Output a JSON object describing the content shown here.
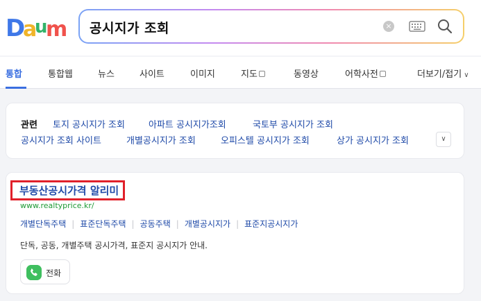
{
  "logo": {
    "text": "Daum"
  },
  "search": {
    "query": "공시지가 조회"
  },
  "tabs": [
    {
      "label": "통합"
    },
    {
      "label": "통합웹"
    },
    {
      "label": "뉴스"
    },
    {
      "label": "사이트"
    },
    {
      "label": "이미지"
    },
    {
      "label": "지도"
    },
    {
      "label": "동영상"
    },
    {
      "label": "어학사전"
    },
    {
      "label": "더보기/접기"
    }
  ],
  "related": {
    "label": "관련",
    "items": [
      "토지 공시지가 조회",
      "아파트 공시지가조회",
      "국토부 공시지가 조회",
      "공시지가 조회 사이트",
      "개별공시지가 조회",
      "오피스텔 공시지가 조회",
      "상가 공시지가 조회"
    ]
  },
  "result": {
    "title": "부동산공시가격 알리미",
    "url": "www.realtyprice.kr/",
    "sublinks": [
      "개별단독주택",
      "표준단독주택",
      "공동주택",
      "개별공시지가",
      "표준지공시지가"
    ],
    "description": "단독, 공동, 개별주택 공시가격, 표준지 공시지가 안내.",
    "call_label": "전화"
  }
}
